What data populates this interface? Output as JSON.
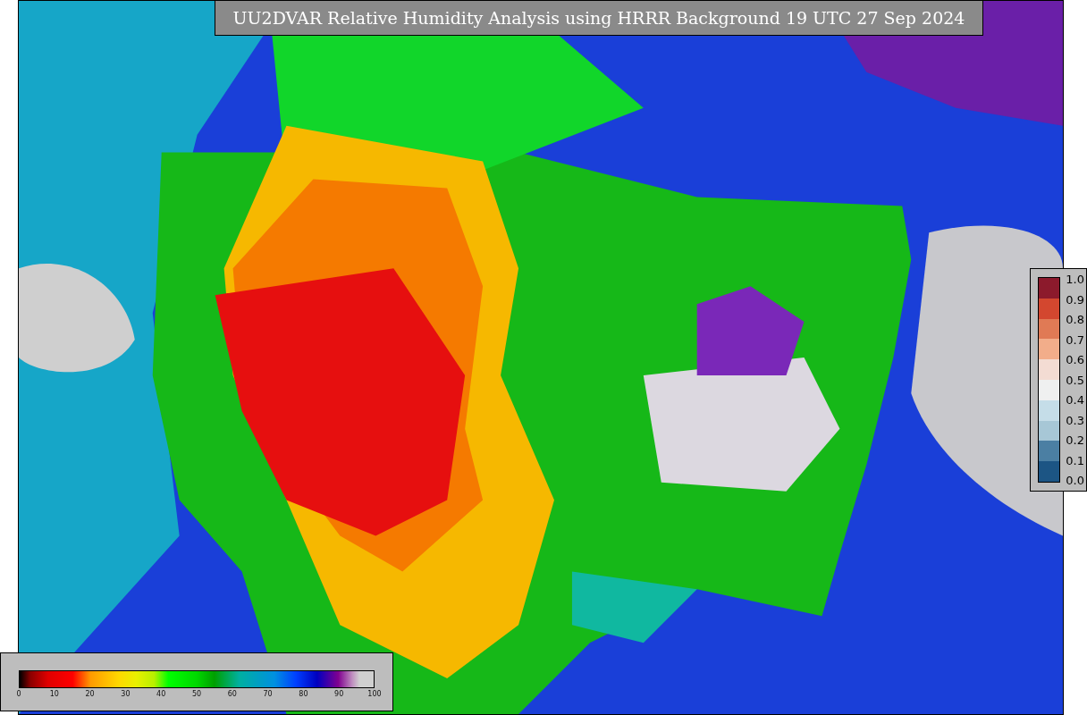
{
  "title": "UU2DVAR Relative Humidity Analysis using HRRR Background 19 UTC 27 Sep 2024",
  "humidity_colorbar": {
    "ticks": [
      "0",
      "10",
      "20",
      "30",
      "40",
      "50",
      "60",
      "70",
      "80",
      "90",
      "100"
    ]
  },
  "observation_legend": {
    "ticks": [
      "1.0",
      "0.9",
      "0.8",
      "0.7",
      "0.6",
      "0.5",
      "0.4",
      "0.3",
      "0.2",
      "0.1",
      "0.0"
    ],
    "bins": [
      {
        "color": "#8c1a2c"
      },
      {
        "color": "#d3472f"
      },
      {
        "color": "#e07a55"
      },
      {
        "color": "#f2ad8a"
      },
      {
        "color": "#f3dcd3"
      },
      {
        "color": "#eff0f0"
      },
      {
        "color": "#c5dde8"
      },
      {
        "color": "#a7c7d6"
      },
      {
        "color": "#4b7fa3"
      },
      {
        "color": "#1c5584"
      }
    ]
  }
}
